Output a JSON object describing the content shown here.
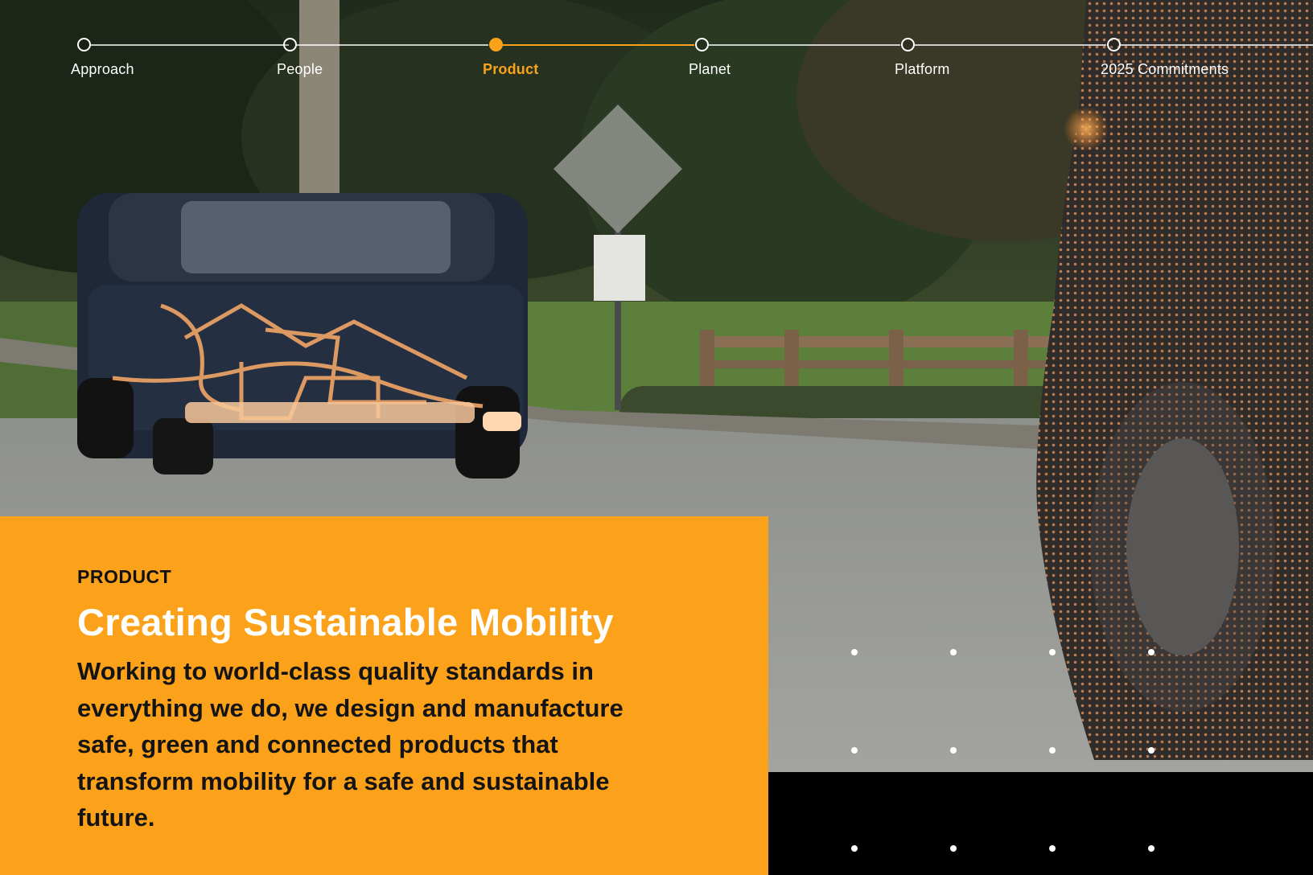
{
  "progress_nav": {
    "steps": [
      {
        "label": "Approach",
        "active": false
      },
      {
        "label": "People",
        "active": false
      },
      {
        "label": "Product",
        "active": true
      },
      {
        "label": "Planet",
        "active": false
      },
      {
        "label": "Platform",
        "active": false
      },
      {
        "label": "2025 Commitments",
        "active": false
      }
    ]
  },
  "section": {
    "eyebrow": "PRODUCT",
    "headline": "Creating Sustainable Mobility",
    "body": "Working to world-class quality standards in everything we do, we design and manufacture safe, green and connected products that transform mobility for a safe and sustainable future."
  },
  "colors": {
    "accent": "#fba11a",
    "active_step": "#f9a21a",
    "headline": "#ffffff",
    "body_text": "#141414",
    "band": "#000000"
  },
  "hero_image": {
    "alt_subject": "SUV on a road with glowing orange wiring overlay and dotted point-cloud car in foreground"
  }
}
